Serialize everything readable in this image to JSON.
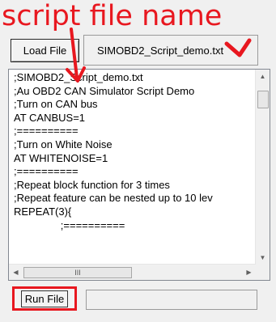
{
  "annotation": {
    "label": "script file name",
    "color": "#e8171f"
  },
  "toolbar": {
    "load_label": "Load File",
    "run_label": "Run File"
  },
  "file_field": {
    "value": "SIMOBD2_Script_demo.txt"
  },
  "editor": {
    "lines": [
      ";SIMOBD2_Script_demo.txt",
      ";Au OBD2 CAN Simulator Script Demo",
      ";Turn on CAN bus",
      "AT CANBUS=1",
      ";==========",
      ";Turn on White Noise",
      "AT WHITENOISE=1",
      ";==========",
      ";Repeat block function for 3 times",
      ";Repeat feature can be nested up to 10 lev",
      "REPEAT(3){",
      "                ;=========="
    ],
    "hscroll_thumb": "III"
  },
  "run_status": {
    "value": ""
  }
}
